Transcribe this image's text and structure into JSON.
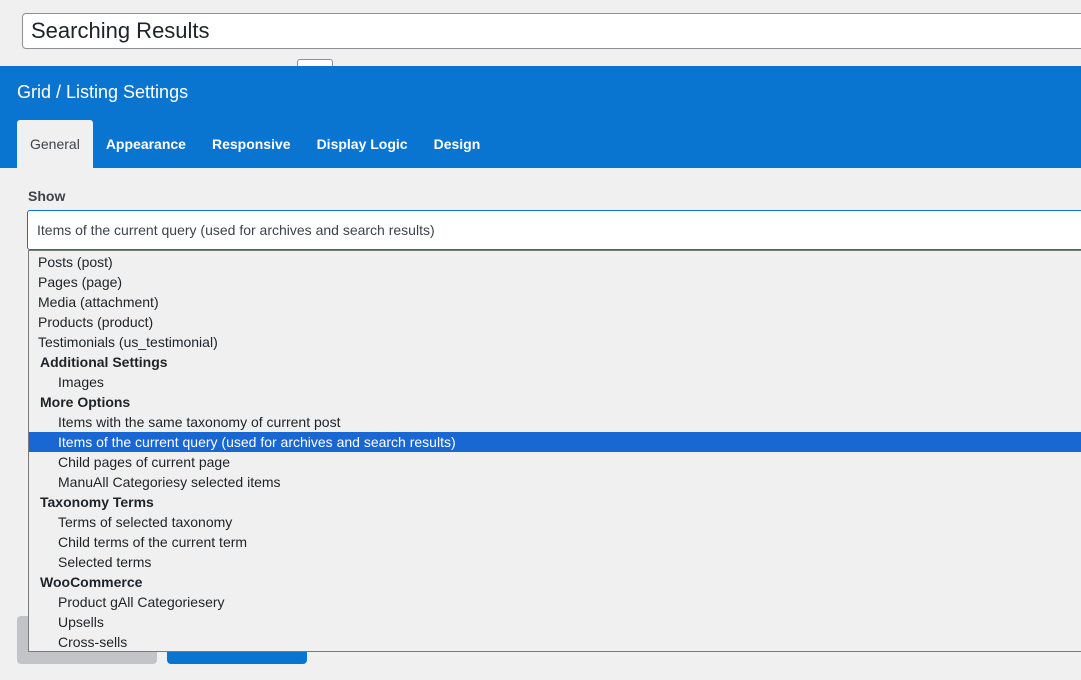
{
  "title_field": {
    "value": "Searching Results"
  },
  "panel": {
    "title": "Grid / Listing Settings",
    "tabs": [
      {
        "label": "General",
        "active": true
      },
      {
        "label": "Appearance"
      },
      {
        "label": "Responsive"
      },
      {
        "label": "Display Logic"
      },
      {
        "label": "Design"
      }
    ]
  },
  "show_field": {
    "label": "Show",
    "selected_value": "Items of the current query (used for archives and search results)",
    "options": [
      {
        "label": "Posts (post)",
        "kind": "option"
      },
      {
        "label": "Pages (page)",
        "kind": "option"
      },
      {
        "label": "Media (attachment)",
        "kind": "option"
      },
      {
        "label": "Products (product)",
        "kind": "option"
      },
      {
        "label": "Testimonials (us_testimonial)",
        "kind": "option"
      },
      {
        "label": "Additional Settings",
        "kind": "group"
      },
      {
        "label": "Images",
        "kind": "sub"
      },
      {
        "label": "More Options",
        "kind": "group"
      },
      {
        "label": "Items with the same taxonomy of current post",
        "kind": "sub"
      },
      {
        "label": "Items of the current query (used for archives and search results)",
        "kind": "sub",
        "selected": true
      },
      {
        "label": "Child pages of current page",
        "kind": "sub"
      },
      {
        "label": "ManuAll Categoriesy selected items",
        "kind": "sub"
      },
      {
        "label": "Taxonomy Terms",
        "kind": "group"
      },
      {
        "label": "Terms of selected taxonomy",
        "kind": "sub"
      },
      {
        "label": "Child terms of the current term",
        "kind": "sub"
      },
      {
        "label": "Selected terms",
        "kind": "sub"
      },
      {
        "label": "WooCommerce",
        "kind": "group"
      },
      {
        "label": "Product gAll Categoriesery",
        "kind": "sub"
      },
      {
        "label": "Upsells",
        "kind": "sub"
      },
      {
        "label": "Cross-sells",
        "kind": "sub"
      }
    ]
  },
  "colors": {
    "accent": "#0a74d1",
    "selected_option": "#1967d2"
  }
}
